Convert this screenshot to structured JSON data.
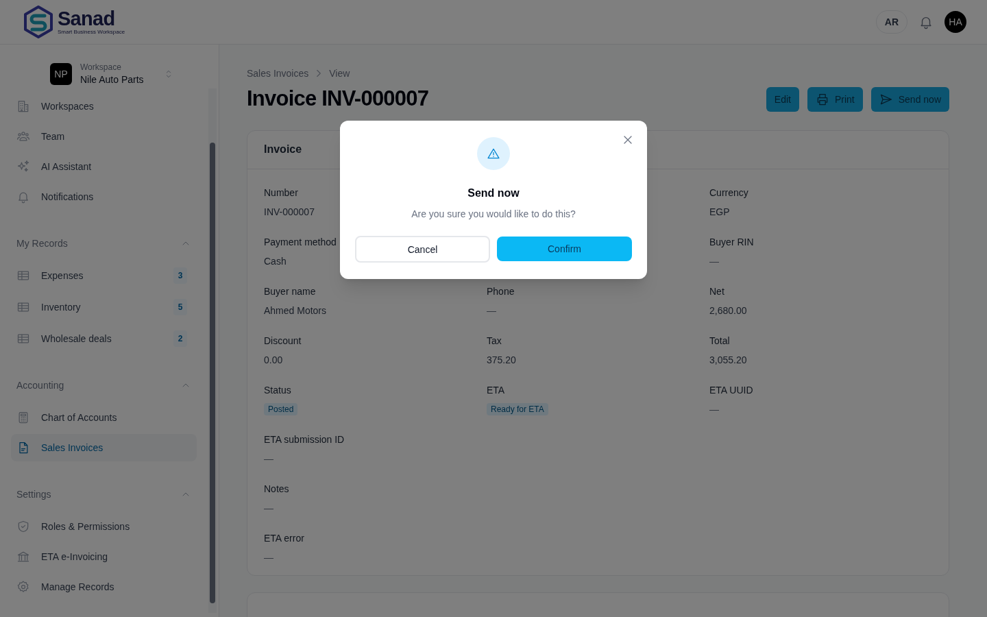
{
  "header": {
    "brand": "Sanad",
    "tagline": "Smart Business Workspace",
    "language": "AR",
    "avatar": "HA"
  },
  "sidebar": {
    "workspace": {
      "label": "Workspace",
      "name": "Nile Auto Parts",
      "initials": "NP"
    },
    "items": [
      {
        "label": "Workspaces",
        "selected": false
      },
      {
        "label": "Team",
        "selected": false
      },
      {
        "label": "AI Assistant",
        "selected": false
      },
      {
        "label": "Notifications",
        "selected": false
      }
    ],
    "sections": [
      {
        "title": "My Records",
        "expanded": true,
        "items": [
          {
            "label": "Expenses",
            "badge": "3",
            "selected": false
          },
          {
            "label": "Inventory",
            "badge": "5",
            "selected": false
          },
          {
            "label": "Wholesale deals",
            "badge": "2",
            "selected": false
          }
        ]
      },
      {
        "title": "Accounting",
        "expanded": true,
        "items": [
          {
            "label": "Chart of Accounts",
            "selected": false
          },
          {
            "label": "Sales Invoices",
            "selected": true
          }
        ]
      },
      {
        "title": "Settings",
        "expanded": true,
        "items": [
          {
            "label": "Roles & Permissions",
            "selected": false
          },
          {
            "label": "ETA e-Invoicing",
            "selected": false
          },
          {
            "label": "Manage Records",
            "selected": false
          }
        ]
      }
    ]
  },
  "breadcrumb": [
    "Sales Invoices",
    "View"
  ],
  "title": "Invoice INV-000007",
  "actions": [
    {
      "label": "Edit"
    },
    {
      "label": "Print"
    },
    {
      "label": "Send now"
    }
  ],
  "card": {
    "title": "Invoice",
    "rows": [
      [
        {
          "kind": "text",
          "label": "Number",
          "value": "INV-000007"
        },
        {
          "kind": "covered"
        },
        {
          "kind": "text",
          "label": "Currency",
          "value": "EGP"
        }
      ],
      [
        {
          "kind": "text",
          "label": "Payment method",
          "value": "Cash"
        },
        {
          "kind": "covered"
        },
        {
          "kind": "empty",
          "label": "Buyer RIN",
          "value": "—"
        }
      ],
      [
        {
          "kind": "text",
          "label": "Buyer name",
          "value": "Ahmed Motors"
        },
        {
          "kind": "empty",
          "label": "Phone",
          "value": "—"
        },
        {
          "kind": "text",
          "label": "Net",
          "value": "2,680.00"
        }
      ],
      [
        {
          "kind": "text",
          "label": "Discount",
          "value": "0.00"
        },
        {
          "kind": "text",
          "label": "Tax",
          "value": "375.20"
        },
        {
          "kind": "text",
          "label": "Total",
          "value": "3,055.20"
        }
      ],
      [
        {
          "kind": "badge",
          "label": "Status",
          "value": "Posted"
        },
        {
          "kind": "badge",
          "label": "ETA",
          "value": "Ready for ETA"
        },
        {
          "kind": "empty",
          "label": "ETA UUID",
          "value": "—"
        }
      ],
      [
        {
          "kind": "empty",
          "label": "ETA submission ID",
          "value": "—"
        }
      ],
      [
        {
          "kind": "empty",
          "label": "Notes",
          "value": "—"
        }
      ],
      [
        {
          "kind": "empty",
          "label": "ETA error",
          "value": "—"
        }
      ]
    ]
  },
  "dialog": {
    "title": "Send now",
    "message": "Are you sure you would like to do this?",
    "buttons": [
      {
        "kind": "secondary",
        "label": "Cancel"
      },
      {
        "kind": "primary",
        "label": "Confirm"
      }
    ]
  }
}
